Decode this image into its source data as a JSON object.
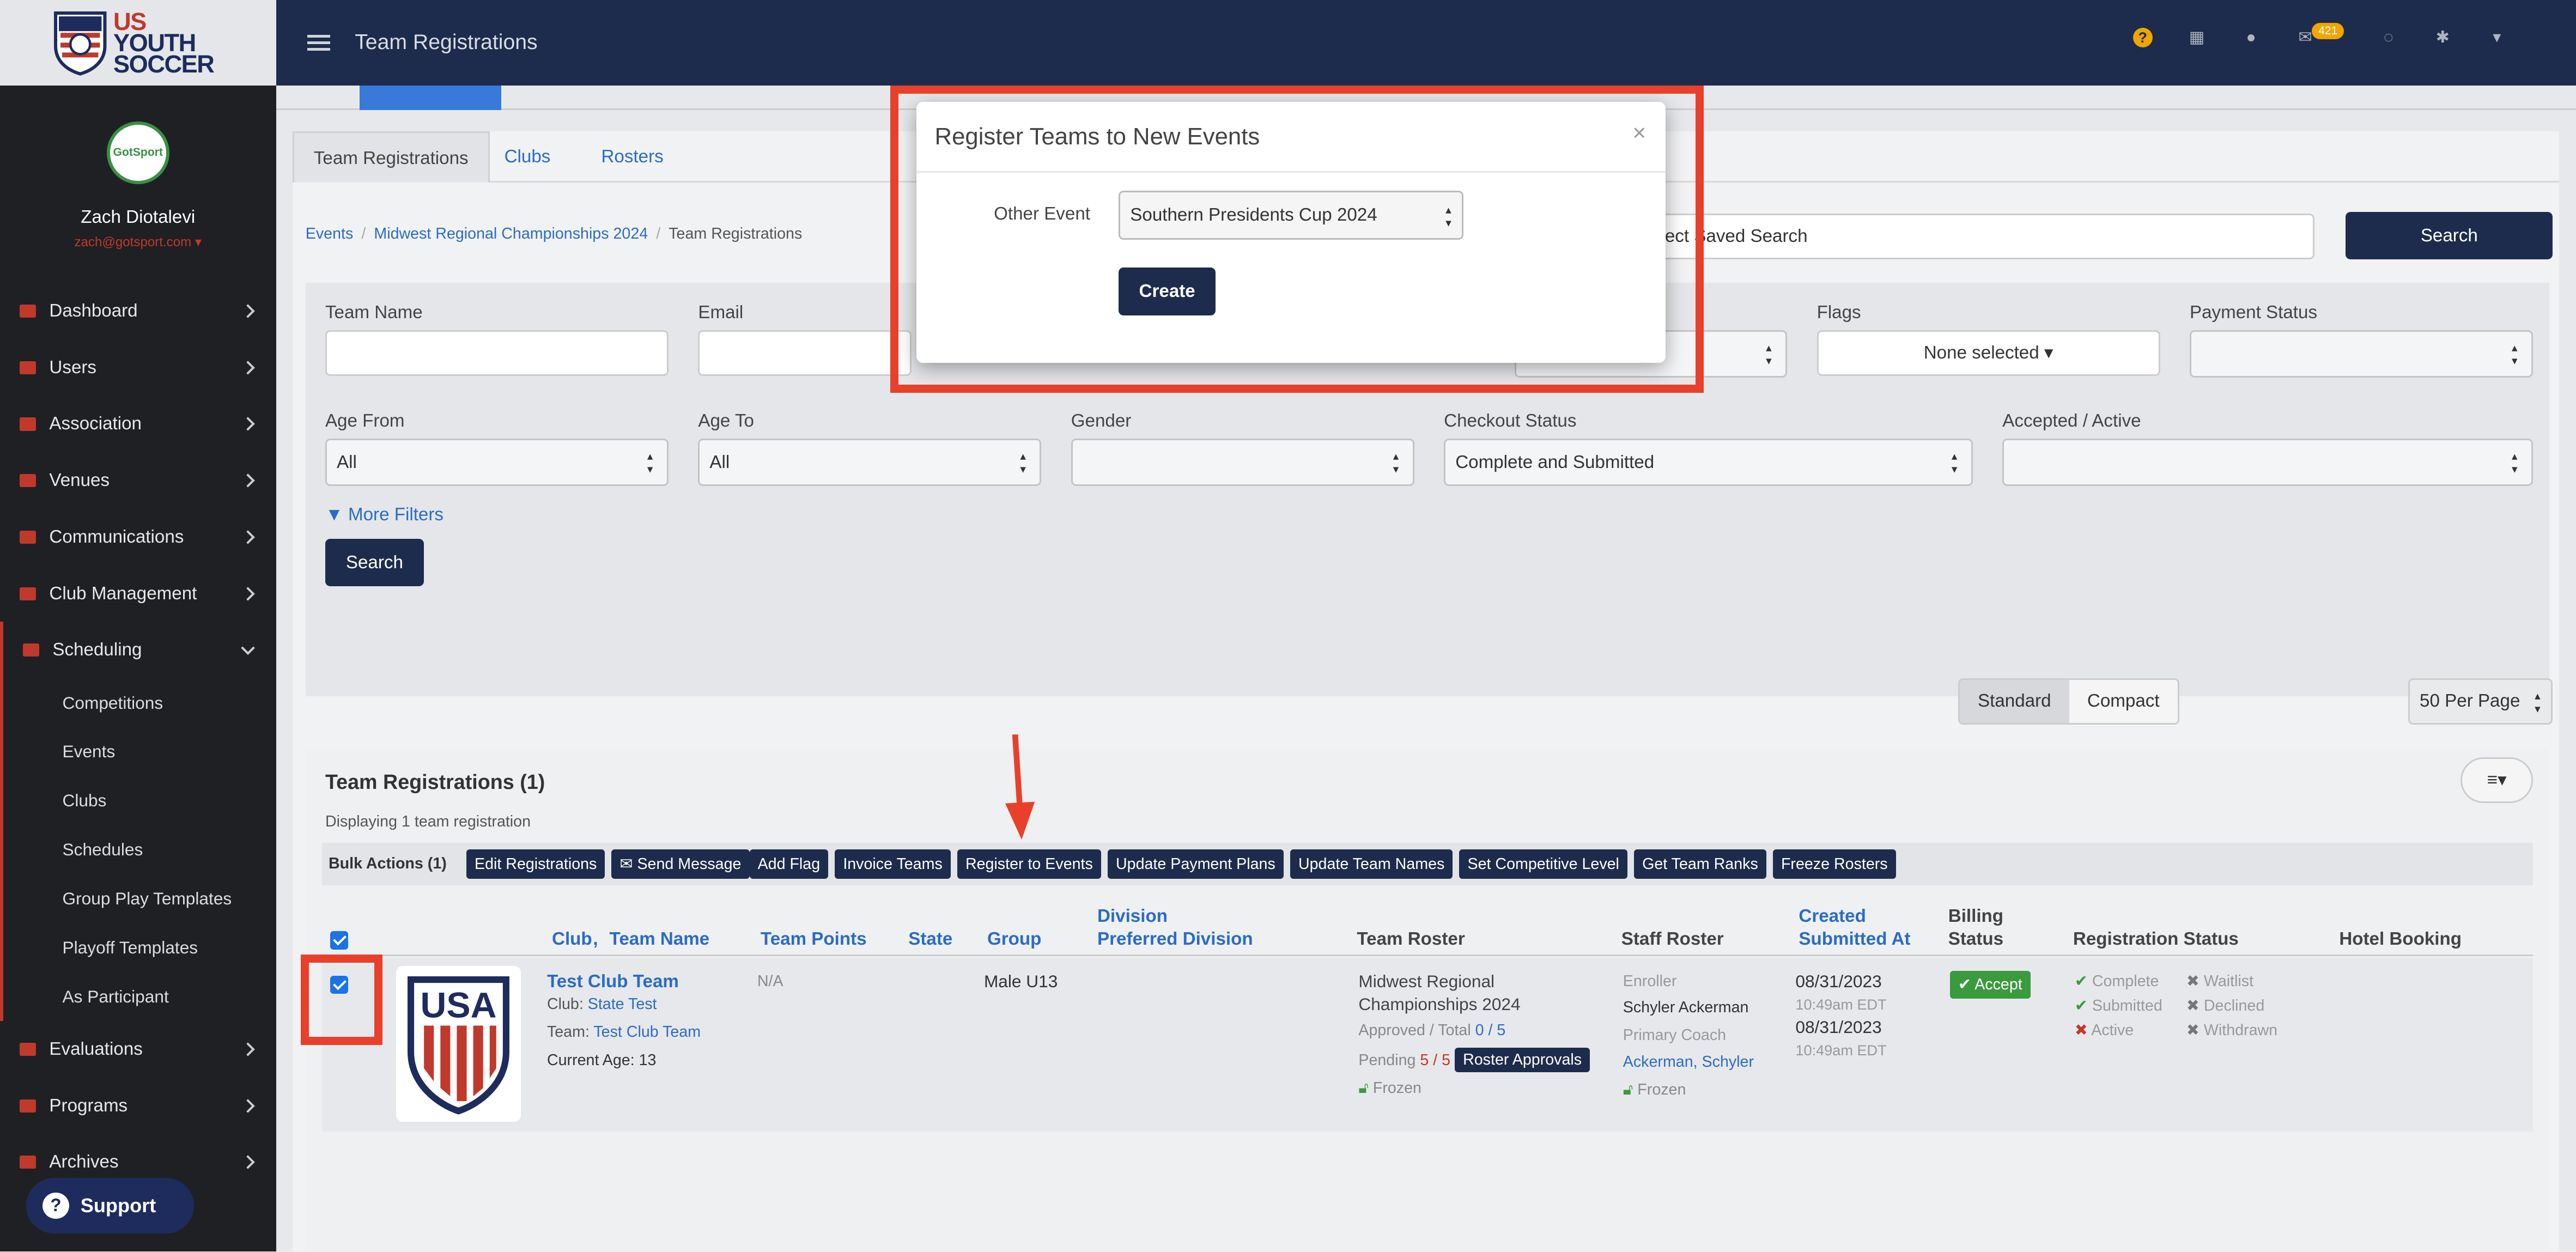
{
  "brand": {
    "logo_lines": [
      "US",
      "YOUTH",
      "SOCCER"
    ],
    "avatar_text": "GotSport"
  },
  "user": {
    "name": "Zach Diotalevi",
    "email": "zach@gotsport.com ▾"
  },
  "sidebar": {
    "items": [
      {
        "label": "Dashboard"
      },
      {
        "label": "Users"
      },
      {
        "label": "Association"
      },
      {
        "label": "Venues"
      },
      {
        "label": "Communications"
      },
      {
        "label": "Club Management"
      },
      {
        "label": "Scheduling"
      }
    ],
    "sub_items": [
      {
        "label": "Competitions"
      },
      {
        "label": "Events"
      },
      {
        "label": "Clubs"
      },
      {
        "label": "Schedules"
      },
      {
        "label": "Group Play Templates"
      },
      {
        "label": "Playoff Templates"
      },
      {
        "label": "As Participant"
      }
    ],
    "bottom_items": [
      {
        "label": "Evaluations"
      },
      {
        "label": "Programs"
      },
      {
        "label": "Archives"
      }
    ],
    "support_label": "Support"
  },
  "topbar": {
    "title": "Team Registrations",
    "mail_count": "421"
  },
  "tabs": [
    {
      "label": "Team Registrations"
    },
    {
      "label": "Clubs"
    },
    {
      "label": "Rosters"
    }
  ],
  "breadcrumb": [
    "Events",
    "Midwest Regional Championships 2024",
    "Team Registrations"
  ],
  "saved_search": {
    "value": "elect Saved Search"
  },
  "search_label": "Search",
  "filters": {
    "team_name": "Team Name",
    "email": "Email",
    "flags": "Flags",
    "flags_value": "None selected ▾",
    "payment_status": "Payment Status",
    "age_from": "Age From",
    "age_from_value": "All",
    "age_to": "Age To",
    "age_to_value": "All",
    "gender": "Gender",
    "checkout_status": "Checkout Status",
    "checkout_value": "Complete and Submitted",
    "accepted_active": "Accepted / Active",
    "more_filters": "More Filters",
    "search": "Search"
  },
  "view": {
    "standard": "Standard",
    "compact": "Compact",
    "per_page": "50 Per Page"
  },
  "results": {
    "title": "Team Registrations (1)",
    "subtitle": "Displaying 1 team registration",
    "menu_icon": "≡▾",
    "bulk_label": "Bulk Actions (1)",
    "bulk_actions": [
      "Edit Registrations",
      "✉ Send Message",
      "Add Flag",
      "Invoice Teams",
      "Register to Events",
      "Update Payment Plans",
      "Update Team Names",
      "Set Competitive Level",
      "Get Team Ranks",
      "Freeze Rosters"
    ]
  },
  "table": {
    "headers": {
      "club": "Club",
      "team_name": "Team Name",
      "team_points": "Team Points",
      "state": "State",
      "group": "Group",
      "division": "Division",
      "preferred_division": "Preferred Division",
      "team_roster": "Team Roster",
      "staff_roster": "Staff Roster",
      "created": "Created",
      "submitted_at": "Submitted At",
      "billing": "Billing",
      "billing_status": "Status",
      "registration_status": "Registration Status",
      "hotel_booking": "Hotel Booking"
    },
    "row": {
      "team_name": "Test Club Team",
      "club_label": "Club:",
      "club_value": "State Test",
      "team_label": "Team:",
      "team_value": "Test Club Team",
      "current_age": "Current Age: 13",
      "team_points": "N/A",
      "group": "Male U13",
      "roster_event_1": "Midwest Regional",
      "roster_event_2": "Championships 2024",
      "approved_label": "Approved / Total",
      "approved_value": "0 / 5",
      "pending_label": "Pending",
      "pending_value": "5 / 5",
      "roster_approvals": "Roster Approvals",
      "frozen": "Frozen",
      "enroller_label": "Enroller",
      "enroller_value": "Schyler Ackerman",
      "primary_coach_label": "Primary Coach",
      "primary_coach_value": "Ackerman, Schyler",
      "staff_frozen": "Frozen",
      "created_date": "08/31/2023",
      "created_time": "10:49am EDT",
      "submitted_date": "08/31/2023",
      "submitted_time": "10:49am EDT",
      "billing": "✔ Accept",
      "status_complete": "Complete",
      "status_submitted": "Submitted",
      "status_active": "Active",
      "status_waitlist": "Waitlist",
      "status_declined": "Declined",
      "status_withdrawn": "Withdrawn",
      "logo_text": "USA"
    }
  },
  "modal": {
    "title": "Register Teams to New Events",
    "close": "×",
    "label": "Other Event",
    "select_value": "Southern Presidents Cup 2024",
    "create": "Create"
  },
  "colors": {
    "annotation": "#e8402a",
    "navy": "#1d2c4c",
    "link": "#2b6cc4"
  }
}
